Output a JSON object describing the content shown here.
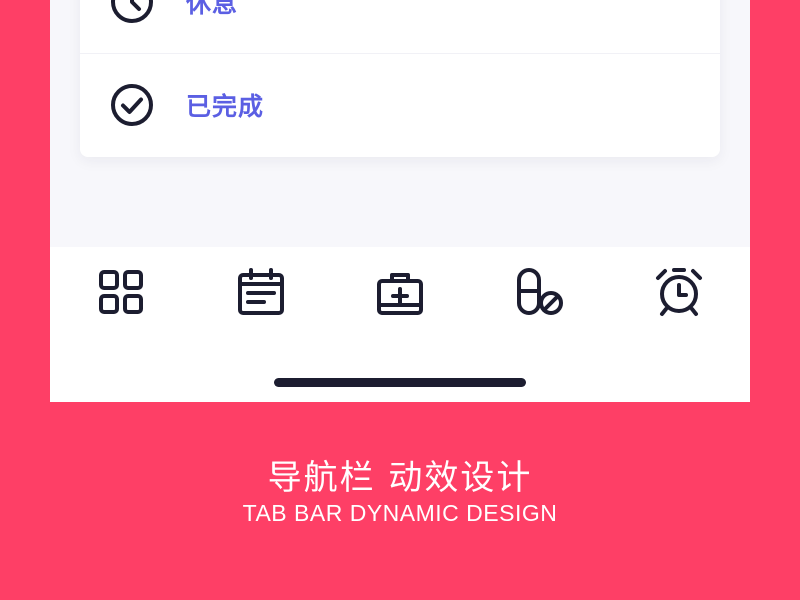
{
  "colors": {
    "background": "#fe3f66",
    "accent_text": "#5b5fe3",
    "icon": "#1c1d30",
    "card": "#ffffff"
  },
  "list": {
    "items": [
      {
        "label": "休息",
        "icon": "clock-icon"
      },
      {
        "label": "已完成",
        "icon": "check-circle-icon"
      }
    ]
  },
  "tabbar": {
    "tabs": [
      {
        "icon": "grid-icon"
      },
      {
        "icon": "calendar-icon"
      },
      {
        "icon": "medical-kit-icon"
      },
      {
        "icon": "pill-icon"
      },
      {
        "icon": "alarm-clock-icon"
      }
    ]
  },
  "caption": {
    "title": "导航栏 动效设计",
    "subtitle": "TAB BAR DYNAMIC DESIGN"
  }
}
